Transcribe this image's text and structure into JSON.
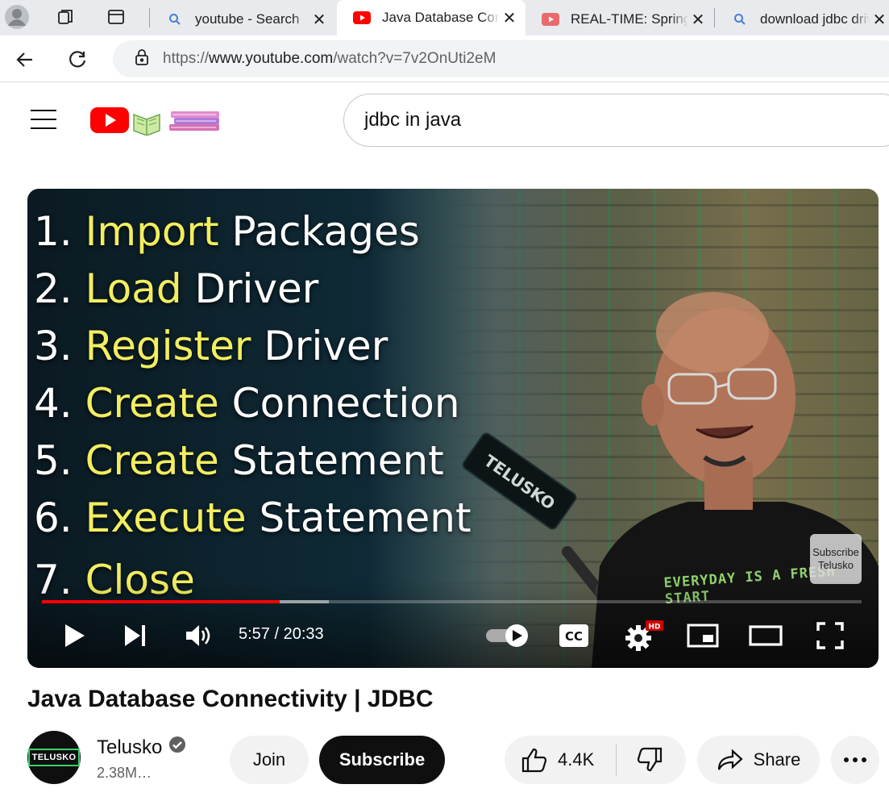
{
  "browser": {
    "tabs": [
      {
        "title": "youtube - Search",
        "favicon": "search-icon"
      },
      {
        "title": "Java Database Connectivity | JDBC",
        "favicon": "youtube-icon",
        "active": true
      },
      {
        "title": "REAL-TIME: Spring",
        "favicon": "youtube-icon"
      },
      {
        "title": "download jdbc driver",
        "favicon": "search-icon"
      }
    ],
    "url_prefix": "https://",
    "url_domain": "www.youtube.com",
    "url_path": "/watch?v=7v2OnUti2eM"
  },
  "youtube": {
    "search_value": "jdbc in java"
  },
  "player": {
    "steps": [
      {
        "num": "1.",
        "hl": "Import",
        "rest": "Packages"
      },
      {
        "num": "2.",
        "hl": "Load",
        "rest": "Driver"
      },
      {
        "num": "3.",
        "hl": "Register",
        "rest": "Driver"
      },
      {
        "num": "4.",
        "hl": "Create",
        "rest": "Connection"
      },
      {
        "num": "5.",
        "hl": "Create",
        "rest": "Statement"
      },
      {
        "num": "6.",
        "hl": "Execute",
        "rest": "Statement"
      },
      {
        "num": "7.",
        "hl": "Close",
        "rest": ""
      }
    ],
    "mic_brand": "TELUSKO",
    "shirt_text": "EVERYDAY IS A FRESH START",
    "watermark_line1": "Subscribe",
    "watermark_line2": "Telusko",
    "time": "5:57 / 20:33",
    "played_fraction": 0.29,
    "buffered_fraction": 0.35,
    "hd_badge": "HD",
    "cc_label": "CC"
  },
  "video": {
    "title": "Java Database Connectivity | JDBC",
    "channel": "Telusko",
    "avatar_text": "TELUSKO",
    "subscribers": "2.38M…",
    "join_label": "Join",
    "subscribe_label": "Subscribe",
    "likes": "4.4K",
    "share_label": "Share"
  },
  "colors": {
    "youtube_red": "#ff0000",
    "highlight_yellow": "#f2ee5f"
  }
}
